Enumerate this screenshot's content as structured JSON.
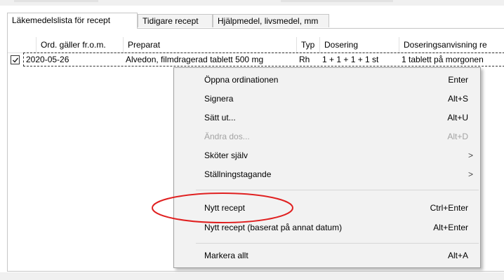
{
  "tabs": [
    {
      "label": "Läkemedelslista för recept",
      "active": true
    },
    {
      "label": "Tidigare recept",
      "active": false
    },
    {
      "label": "Hjälpmedel, livsmedel, mm",
      "active": false
    }
  ],
  "table": {
    "columns": [
      "Ord. gäller fr.o.m.",
      "Preparat",
      "Typ",
      "Dosering",
      "Doseringsanvisning re"
    ],
    "rows": [
      {
        "checked": true,
        "date": "2020-05-26",
        "preparat": "Alvedon, filmdragerad tablett 500 mg",
        "typ": "Rh",
        "dosering": "1 + 1 + 1 + 1 st",
        "anvisning": "1 tablett på morgonen"
      }
    ]
  },
  "context_menu": {
    "items": [
      {
        "label": "Öppna ordinationen",
        "shortcut": "Enter"
      },
      {
        "label": "Signera",
        "shortcut": "Alt+S"
      },
      {
        "label": "Sätt ut...",
        "shortcut": "Alt+U"
      },
      {
        "label": "Ändra dos...",
        "shortcut": "Alt+D",
        "disabled": true
      },
      {
        "label": "Sköter själv",
        "submenu": true
      },
      {
        "label": "Ställningstagande",
        "submenu": true
      },
      {
        "label": "Nytt recept",
        "shortcut": "Ctrl+Enter",
        "highlighted_by_annotation": true
      },
      {
        "label": "Nytt recept (baserat på annat datum)",
        "shortcut": "Alt+Enter"
      },
      {
        "label": "Markera allt",
        "shortcut": "Alt+A"
      }
    ],
    "submenu_arrow": ">"
  },
  "colors": {
    "annotation": "#e02020",
    "disabled_text": "#a3a3a3",
    "menu_bg": "#f2f2f2"
  }
}
